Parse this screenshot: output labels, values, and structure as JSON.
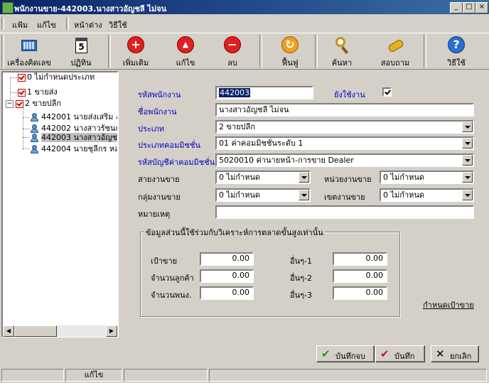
{
  "window": {
    "title": "พนักงานขาย-442003.นางสาวอัญชลี  ไม่จน"
  },
  "menu": [
    "แฟ้ม",
    "แก้ไข",
    "หน้าต่าง",
    "วิธีใช้"
  ],
  "toolbar": {
    "calculator": "เครื่องคิดเลข",
    "calendar": "ปฏิทิน",
    "calendar_day": "5",
    "add": "เพิ่มเติม",
    "edit": "แก้ไข",
    "delete": "ลบ",
    "refresh": "ฟื้นฟู",
    "search": "ค้นหา",
    "inquiry": "สอบถาม",
    "help": "วิธีใช้"
  },
  "tree": {
    "nodes": [
      {
        "label": "0 ไม่กำหนดประเภท"
      },
      {
        "label": "1 ขายส่ง"
      },
      {
        "label": "2 ขายปลีก"
      }
    ],
    "children": [
      {
        "label": "442001 นายส่งเสริม งา"
      },
      {
        "label": "442002 นางสาวรัชนก"
      },
      {
        "label": "442003 นางสาวอัญชลี"
      },
      {
        "label": "442004 นายชุลีกร  หอย"
      }
    ]
  },
  "form": {
    "code_label": "รหัสพนักงาน",
    "code_value": "442003",
    "active_label": "ยังใช้งาน",
    "name_label": "ชื่อพนักงาน",
    "name_value": "นางสาวอัญชลี  ไม่จน",
    "type_label": "ประเภท",
    "type_value": "2 ขายปลีก",
    "commission_type_label": "ประเภทคอมมิชชั่น",
    "commission_type_value": "01 ค่าคอมมิชชั่นระดับ 1",
    "commission_account_label": "รหัสบัญชีค่าคอมมิชชั่น",
    "commission_account_value": "5020010 ค่านายหน้า-การขาย Dealer",
    "line_label": "สายงานขาย",
    "line_value": "0 ไม่กำหนด",
    "unit_label": "หน่วยงานขาย",
    "unit_value": "0 ไม่กำหนด",
    "group_label": "กลุ่มงานขาย",
    "group_value": "0 ไม่กำหนด",
    "zone_label": "เขตงานขาย",
    "zone_value": "0 ไม่กำหนด",
    "note_label": "หมายเหตุ",
    "note_value": ""
  },
  "analysis": {
    "title": "ข้อมูลส่วนนี้ใช้ร่วมกับวิเคราะห์การตลาดขั้นสูงเท่านั้น",
    "target_label": "เป้าขาย",
    "target_value": "0.00",
    "customers_label": "จำนวนลูกค้า",
    "customers_value": "0.00",
    "staff_label": "จำนวนพนง.",
    "staff_value": "0.00",
    "other1_label": "อื่นๆ-1",
    "other1_value": "0.00",
    "other2_label": "อื่นๆ-2",
    "other2_value": "0.00",
    "other3_label": "อื่นๆ-3",
    "other3_value": "0.00"
  },
  "set_target_link": "กำหนดเป้าขาย",
  "buttons": {
    "save_close": "บันทึกจบ",
    "save": "บันทึก",
    "cancel": "ยกเลิก"
  },
  "status": {
    "mode": "แก้ไข"
  }
}
